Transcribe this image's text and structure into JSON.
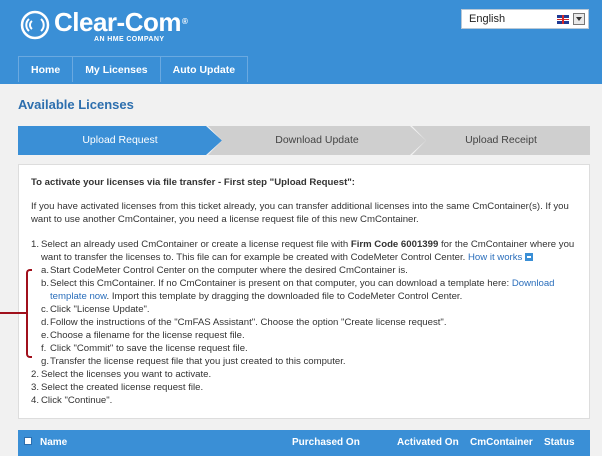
{
  "brand": {
    "name": "Clear-Com",
    "tagline": "AN HME COMPANY"
  },
  "language": {
    "selected": "English"
  },
  "nav": {
    "items": [
      "Home",
      "My Licenses",
      "Auto Update"
    ]
  },
  "page_title": "Available Licenses",
  "steps": [
    "Upload Request",
    "Download Update",
    "Upload Receipt"
  ],
  "content": {
    "heading": "To activate your licenses via file transfer - First step \"Upload Request\":",
    "intro": "If you have activated licenses from this ticket already, you can transfer additional licenses into the same CmContainer(s). If you want to use another CmContainer, you need a license request file of this new CmContainer.",
    "step1_pre": "Select an already used CmContainer or create a license request file with ",
    "step1_firmcode": "Firm Code 6001399",
    "step1_post": " for the CmContainer where you want to transfer the licenses to. This file can for example be created with CodeMeter Control Center. ",
    "how_it_works": "How it works",
    "sub": {
      "a": "Start CodeMeter Control Center on the computer where the desired CmContainer is.",
      "b_pre": "Select this CmContainer. If no CmContainer is present on that computer, you can download a template here: ",
      "b_link": "Download template now",
      "b_post": ". Import this template by dragging the downloaded file to CodeMeter Control Center.",
      "c": "Click \"License Update\".",
      "d": "Follow the instructions of the \"CmFAS Assistant\". Choose the option \"Create license request\".",
      "e": "Choose a filename for the license request file.",
      "f": "Click \"Commit\" to save the license request file.",
      "g": "Transfer the license request file that you just created to this computer."
    },
    "step2": "Select the licenses you want to activate.",
    "step3": "Select the created license request file.",
    "step4": "Click \"Continue\"."
  },
  "table": {
    "columns": [
      "Name",
      "Purchased On",
      "Activated On",
      "CmContainer",
      "Status"
    ]
  },
  "colors": {
    "brand_blue": "#3a8fd6",
    "link": "#2a6ebb",
    "annotation_red": "#a0101c"
  }
}
